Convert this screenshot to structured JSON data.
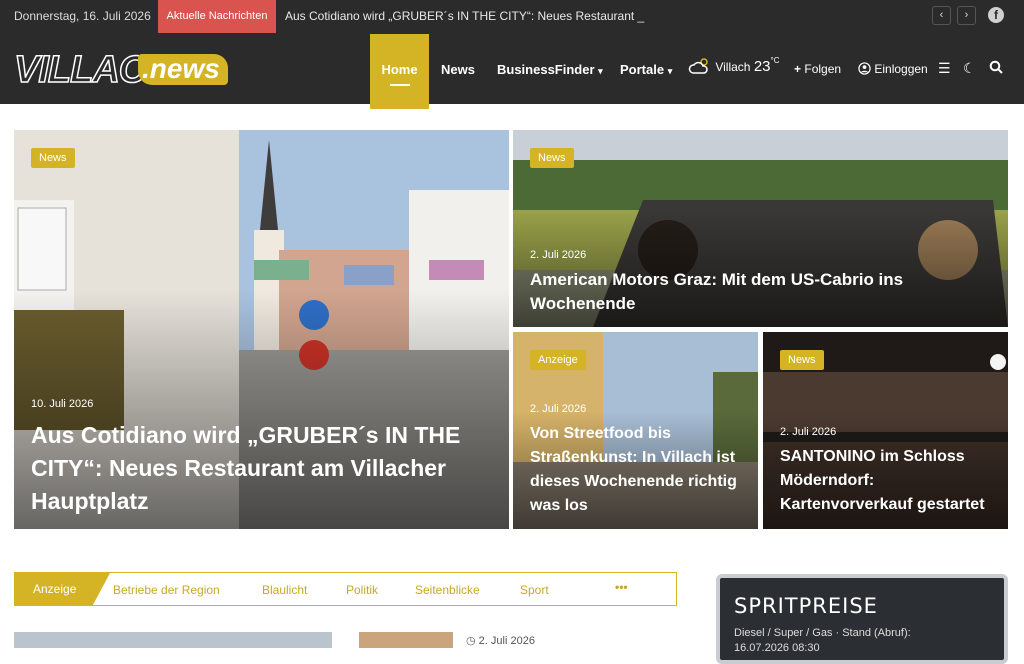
{
  "topbar": {
    "date": "Donnerstag, 16. Juli 2026",
    "breaking_label": "Aktuelle Nachrichten",
    "ticker_text": "Aus Cotidiano wird „GRUBER´s IN THE CITY“: Neues Restaurant _",
    "prev_icon": "chevron-left-icon",
    "next_icon": "chevron-right-icon",
    "facebook_icon": "facebook-icon"
  },
  "header": {
    "logo_villach": "VILLACH",
    "logo_news": ".news",
    "nav": [
      "Home",
      "News",
      "BusinessFinder",
      "Portale"
    ],
    "weather_city": "Villach",
    "weather_temp": "23",
    "weather_unit": "°C",
    "follow_label": "Folgen",
    "login_label": "Einloggen"
  },
  "hero": [
    {
      "badge": "News",
      "date": "10. Juli 2026",
      "title": "Aus Cotidiano wird „GRUBER´s IN THE CITY“: Neues Restaurant am Villacher Hauptplatz"
    },
    {
      "badge": "News",
      "date": "2. Juli 2026",
      "title": "American Motors Graz: Mit dem US-Cabrio ins Wochenende"
    },
    {
      "badge": "Anzeige",
      "date": "2. Juli 2026",
      "title": "Von Streetfood bis Straßenkunst: In Villach ist dieses Wochenende richtig was los"
    },
    {
      "badge": "News",
      "date": "2. Juli 2026",
      "title": "SANTONINO im Schloss Möderndorf: Kartenvorverkauf gestartet"
    }
  ],
  "tabs": [
    "Anzeige",
    "Betriebe der Region",
    "Blaulicht",
    "Politik",
    "Seitenblicke",
    "Sport",
    "•••"
  ],
  "fuel": {
    "heading": "SPRITPREISE",
    "line1": "Diesel / Super / Gas · Stand (Abruf):",
    "line2": "16.07.2026 08:30"
  },
  "list_date": "2. Juli 2026",
  "colors": {
    "accent": "#d4b324",
    "dark": "#2b2b2b",
    "breaking": "#d9534f"
  }
}
